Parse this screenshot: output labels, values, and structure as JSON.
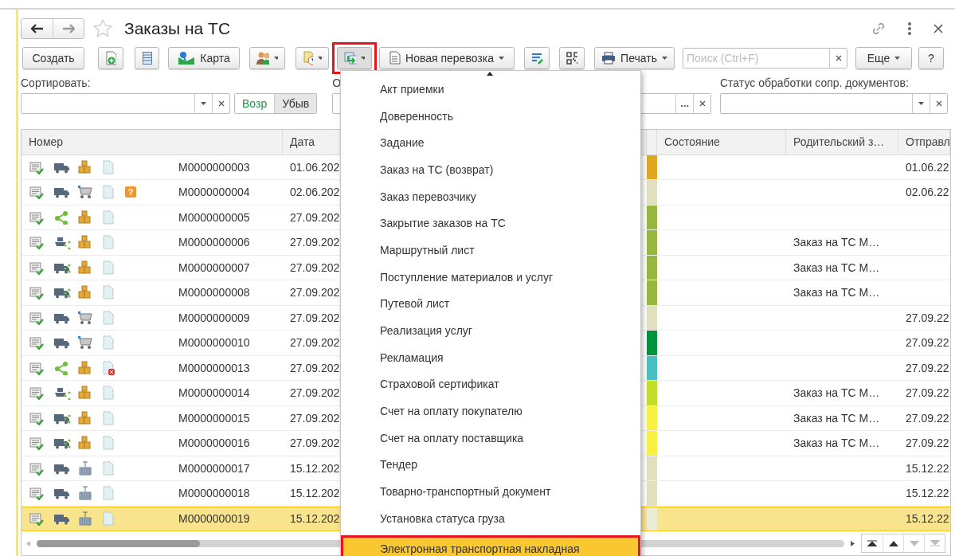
{
  "window": {
    "title": "Заказы на ТС"
  },
  "toolbar": {
    "create": "Создать",
    "map": "Карта",
    "create_based_on": {
      "marked": true
    },
    "new_transport": "Новая перевозка",
    "print": "Печать",
    "search": {
      "placeholder": "Поиск (Ctrl+F)"
    },
    "more": "Еще",
    "help": "?"
  },
  "filters": {
    "sort_label": "Сортировать:",
    "sort_order": [
      {
        "label": "Возр",
        "selected": true
      },
      {
        "label": "Убыв",
        "selected": false
      }
    ],
    "second_label": "О",
    "second_select": "...",
    "status_label": "Статус обработки сопр. документов:"
  },
  "table": {
    "columns": [
      "Номер",
      "Дата",
      "",
      "",
      "Состояние",
      "Родительский з…",
      "Отправл"
    ],
    "rows": [
      {
        "icons": [
          {
            "kind": "document-check"
          },
          {
            "kind": "truck"
          },
          {
            "kind": "boxes"
          },
          {
            "kind": "document"
          }
        ],
        "number": "М0000000003",
        "date": "01.06.202",
        "color": "#e0a820",
        "parent": "",
        "sent": "01.06.22",
        "selected": false
      },
      {
        "icons": [
          {
            "kind": "document-check"
          },
          {
            "kind": "truck"
          },
          {
            "kind": "cart"
          },
          {
            "kind": "document"
          },
          {
            "kind": "badge",
            "label": "?"
          }
        ],
        "number": "М0000000004",
        "date": "02.06.202",
        "color": "#e0e0c0",
        "parent": "",
        "sent": "02.06.22",
        "selected": false
      },
      {
        "icons": [
          {
            "kind": "document-check"
          },
          {
            "kind": "share"
          },
          {
            "kind": "boxes"
          },
          {
            "kind": "document"
          }
        ],
        "number": "М0000000005",
        "date": "27.09.202",
        "color": "#97b73e",
        "parent": "",
        "sent": "",
        "selected": false
      },
      {
        "icons": [
          {
            "kind": "document-check"
          },
          {
            "kind": "ship"
          },
          {
            "kind": "boxes"
          },
          {
            "kind": "document"
          }
        ],
        "number": "М0000000006",
        "date": "27.09.202",
        "color": "#97b73e",
        "parent": "Заказ на ТС М…",
        "sent": "",
        "selected": false
      },
      {
        "icons": [
          {
            "kind": "document-check"
          },
          {
            "kind": "truck-share"
          },
          {
            "kind": "boxes"
          },
          {
            "kind": "document"
          }
        ],
        "number": "М0000000007",
        "date": "27.09.202",
        "color": "#97b73e",
        "parent": "Заказ на ТС М…",
        "sent": "",
        "selected": false
      },
      {
        "icons": [
          {
            "kind": "document-check"
          },
          {
            "kind": "truck-share"
          },
          {
            "kind": "boxes"
          },
          {
            "kind": "document"
          }
        ],
        "number": "М0000000008",
        "date": "27.09.202",
        "color": "#97b73e",
        "parent": "Заказ на ТС М…",
        "sent": "",
        "selected": false
      },
      {
        "icons": [
          {
            "kind": "document-check"
          },
          {
            "kind": "truck"
          },
          {
            "kind": "cart"
          },
          {
            "kind": "document"
          }
        ],
        "number": "М0000000009",
        "date": "27.09.202",
        "color": "#e0e0c0",
        "parent": "",
        "sent": "27.09.22",
        "selected": false
      },
      {
        "icons": [
          {
            "kind": "document-check"
          },
          {
            "kind": "truck"
          },
          {
            "kind": "cart"
          },
          {
            "kind": "document"
          }
        ],
        "number": "М0000000010",
        "date": "27.09.202",
        "color": "#00923f",
        "parent": "",
        "sent": "27.09.22",
        "selected": false
      },
      {
        "icons": [
          {
            "kind": "document-check"
          },
          {
            "kind": "share"
          },
          {
            "kind": "boxes"
          },
          {
            "kind": "document-error"
          }
        ],
        "number": "М0000000013",
        "date": "27.09.202",
        "color": "#4bbfbf",
        "parent": "",
        "sent": "27.09.22",
        "selected": false
      },
      {
        "icons": [
          {
            "kind": "document-check"
          },
          {
            "kind": "ship"
          },
          {
            "kind": "boxes"
          },
          {
            "kind": "document"
          }
        ],
        "number": "М0000000014",
        "date": "27.09.202",
        "color": "#c4dc2a",
        "parent": "Заказ на ТС М…",
        "sent": "27.09.22",
        "selected": false
      },
      {
        "icons": [
          {
            "kind": "document-check"
          },
          {
            "kind": "truck-share"
          },
          {
            "kind": "boxes"
          },
          {
            "kind": "document"
          }
        ],
        "number": "М0000000015",
        "date": "27.09.202",
        "color": "#f8f040",
        "parent": "Заказ на ТС М…",
        "sent": "27.09.22",
        "selected": false
      },
      {
        "icons": [
          {
            "kind": "document-check"
          },
          {
            "kind": "truck-share"
          },
          {
            "kind": "boxes"
          },
          {
            "kind": "document"
          }
        ],
        "number": "М0000000016",
        "date": "27.09.202",
        "color": "#f8f040",
        "parent": "Заказ на ТС М…",
        "sent": "27.09.22",
        "selected": false
      },
      {
        "icons": [
          {
            "kind": "document-check"
          },
          {
            "kind": "truck"
          },
          {
            "kind": "container"
          },
          {
            "kind": "document"
          }
        ],
        "number": "М0000000017",
        "date": "15.12.202",
        "color": "#e0e0c0",
        "parent": "",
        "sent": "15.12.22",
        "selected": false
      },
      {
        "icons": [
          {
            "kind": "document-check"
          },
          {
            "kind": "truck"
          },
          {
            "kind": "container"
          },
          {
            "kind": "document"
          }
        ],
        "number": "М0000000018",
        "date": "15.12.202",
        "color": "#e0e0c0",
        "parent": "",
        "sent": "15.12.22",
        "selected": false
      },
      {
        "icons": [
          {
            "kind": "document-check"
          },
          {
            "kind": "truck"
          },
          {
            "kind": "container"
          },
          {
            "kind": "document"
          }
        ],
        "number": "М0000000019",
        "date": "15.12.202",
        "color": "#ecebd8",
        "parent": "",
        "sent": "15.12.22",
        "selected": true
      }
    ]
  },
  "menu": {
    "items": [
      {
        "label": "Акт приемки",
        "selected": false
      },
      {
        "label": "Доверенность",
        "selected": false
      },
      {
        "label": "Задание",
        "selected": false
      },
      {
        "label": "Заказ на ТС (возврат)",
        "selected": false
      },
      {
        "label": "Заказ перевозчику",
        "selected": false
      },
      {
        "label": "Закрытие заказов на ТС",
        "selected": false
      },
      {
        "label": "Маршрутный лист",
        "selected": false
      },
      {
        "label": "Поступление материалов и услуг",
        "selected": false
      },
      {
        "label": "Путевой лист",
        "selected": false
      },
      {
        "label": "Реализация услуг",
        "selected": false
      },
      {
        "label": "Рекламация",
        "selected": false
      },
      {
        "label": "Страховой сертификат",
        "selected": false
      },
      {
        "label": "Счет на оплату покупателю",
        "selected": false
      },
      {
        "label": "Счет на оплату поставщика",
        "selected": false
      },
      {
        "label": "Тендер",
        "selected": false
      },
      {
        "label": "Товарно-транспортный документ",
        "selected": false
      },
      {
        "label": "Установка статуса груза",
        "selected": false
      },
      {
        "label": "Электронная транспортная накладная",
        "selected": true
      }
    ]
  }
}
